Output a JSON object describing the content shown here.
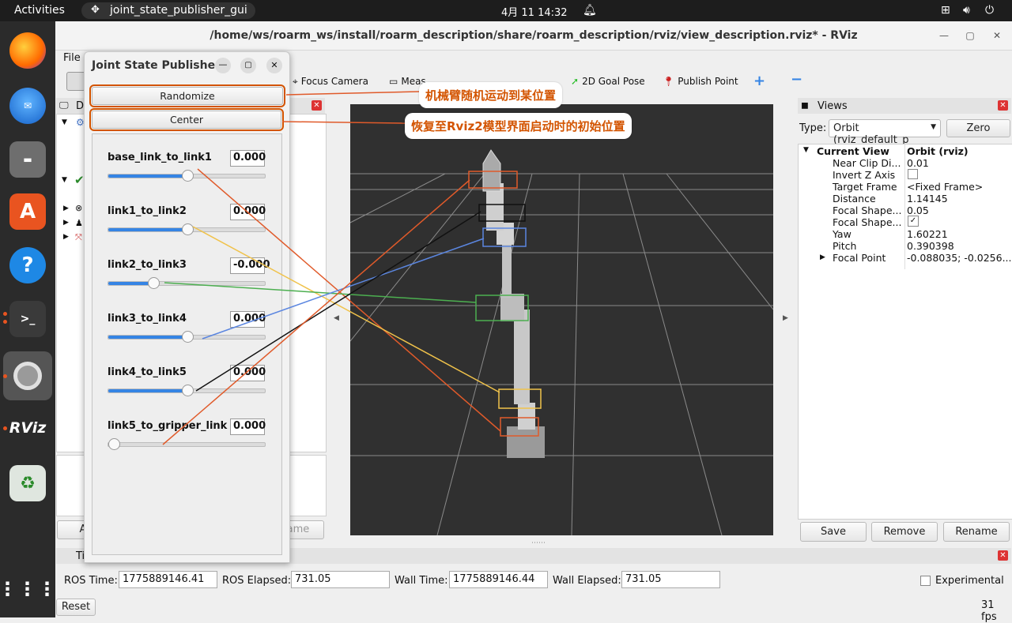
{
  "topbar": {
    "activities": "Activities",
    "app_name": "joint_state_publisher_gui",
    "clock": "4月 11  14:32"
  },
  "rviz": {
    "title": "/home/ws/roarm_ws/install/roarm_description/share/roarm_description/rviz/view_description.rviz* - RViz",
    "menu_file": "File",
    "toolbar": {
      "focus_camera": "Focus Camera",
      "measure": "Meas",
      "goal_pose": "2D Goal Pose",
      "publish_point": "Publish Point"
    },
    "displays": {
      "header": "Di",
      "add_button": "A",
      "rename_button": "ame"
    },
    "views": {
      "header": "Views",
      "type_label": "Type:",
      "type_value": "Orbit (rviz_default_p",
      "zero": "Zero",
      "props": [
        {
          "name": "Current View",
          "value": "Orbit (rviz)"
        },
        {
          "name": "Near Clip Di...",
          "value": "0.01"
        },
        {
          "name": "Invert Z Axis",
          "value": ""
        },
        {
          "name": "Target Frame",
          "value": "<Fixed Frame>"
        },
        {
          "name": "Distance",
          "value": "1.14145"
        },
        {
          "name": "Focal Shape...",
          "value": "0.05"
        },
        {
          "name": "Focal Shape...",
          "value": "✓"
        },
        {
          "name": "Yaw",
          "value": "1.60221"
        },
        {
          "name": "Pitch",
          "value": "0.390398"
        },
        {
          "name": "Focal Point",
          "value": "-0.088035; -0.0256..."
        }
      ],
      "save": "Save",
      "remove": "Remove",
      "rename": "Rename"
    },
    "time": {
      "header": "Ti",
      "ros_time_label": "ROS Time:",
      "ros_time": "1775889146.41",
      "ros_elapsed_label": "ROS Elapsed:",
      "ros_elapsed": "731.05",
      "wall_time_label": "Wall Time:",
      "wall_time": "1775889146.44",
      "wall_elapsed_label": "Wall Elapsed:",
      "wall_elapsed": "731.05",
      "experimental": "Experimental",
      "reset": "Reset",
      "fps": "31 fps"
    }
  },
  "jsp": {
    "title": "Joint State Publisher",
    "randomize": "Randomize",
    "center": "Center",
    "joints": [
      {
        "name": "base_link_to_link1",
        "value": "0.000",
        "position": 0.5
      },
      {
        "name": "link1_to_link2",
        "value": "0.000",
        "position": 0.5
      },
      {
        "name": "link2_to_link3",
        "value": "-0.000",
        "position": 0.27
      },
      {
        "name": "link3_to_link4",
        "value": "0.000",
        "position": 0.5
      },
      {
        "name": "link4_to_link5",
        "value": "0.000",
        "position": 0.5
      },
      {
        "name": "link5_to_gripper_link",
        "value": "0.000",
        "position": 0.0
      }
    ]
  },
  "annotations": {
    "randomize_note": "机械臂随机运动到某位置",
    "center_note": "恢复至Rviz2模型界面启动时的初始位置"
  },
  "colors": {
    "accent": "#3584e4",
    "callout_text": "#d35400",
    "ubuntu_orange": "#e95420"
  },
  "dock_icons": [
    "firefox-icon",
    "thunderbird-icon",
    "files-icon",
    "app-center-icon",
    "help-icon",
    "terminal-icon",
    "settings-icon",
    "rviz-icon",
    "trash-icon",
    "app-grid-icon"
  ]
}
